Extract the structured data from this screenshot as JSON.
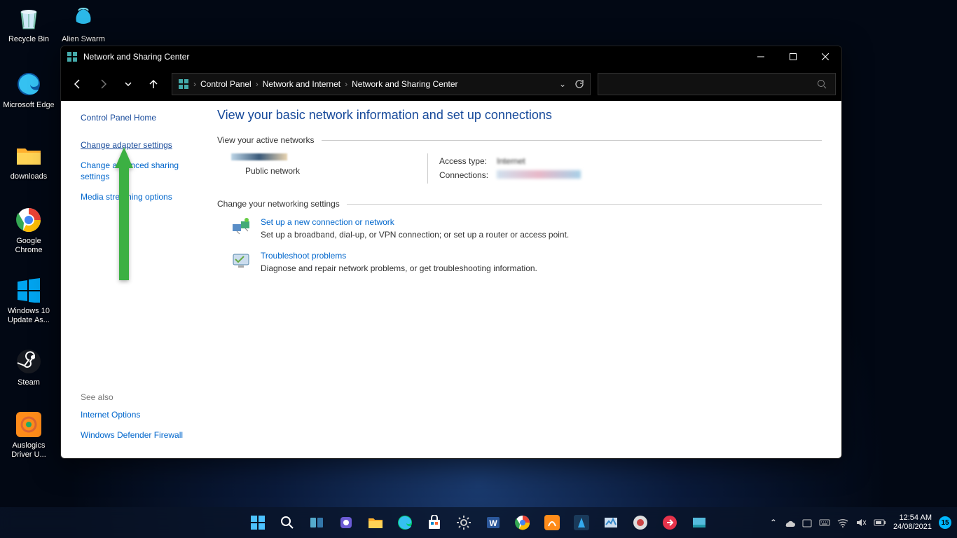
{
  "desktop": {
    "icons": [
      {
        "label": "Recycle Bin"
      },
      {
        "label": "Alien Swarm"
      },
      {
        "label": "Microsoft Edge"
      },
      {
        "label": "downloads"
      },
      {
        "label": "Google Chrome"
      },
      {
        "label": "Windows 10 Update As..."
      },
      {
        "label": "Steam"
      },
      {
        "label": "Auslogics Driver U..."
      }
    ]
  },
  "window": {
    "title": "Network and Sharing Center",
    "breadcrumb": [
      "Control Panel",
      "Network and Internet",
      "Network and Sharing Center"
    ]
  },
  "sidebar": {
    "home": "Control Panel Home",
    "links": [
      "Change adapter settings",
      "Change advanced sharing settings",
      "Media streaming options"
    ],
    "see_also_header": "See also",
    "see_also": [
      "Internet Options",
      "Windows Defender Firewall"
    ]
  },
  "main": {
    "heading": "View your basic network information and set up connections",
    "active_net_legend": "View your active networks",
    "net_type": "Public network",
    "access_type_label": "Access type:",
    "access_type_value": "Internet",
    "connections_label": "Connections:",
    "change_legend": "Change your networking settings",
    "actions": [
      {
        "title": "Set up a new connection or network",
        "desc": "Set up a broadband, dial-up, or VPN connection; or set up a router or access point."
      },
      {
        "title": "Troubleshoot problems",
        "desc": "Diagnose and repair network problems, or get troubleshooting information."
      }
    ]
  },
  "taskbar": {
    "time": "12:54 AM",
    "date": "24/08/2021",
    "notif_count": "15"
  }
}
